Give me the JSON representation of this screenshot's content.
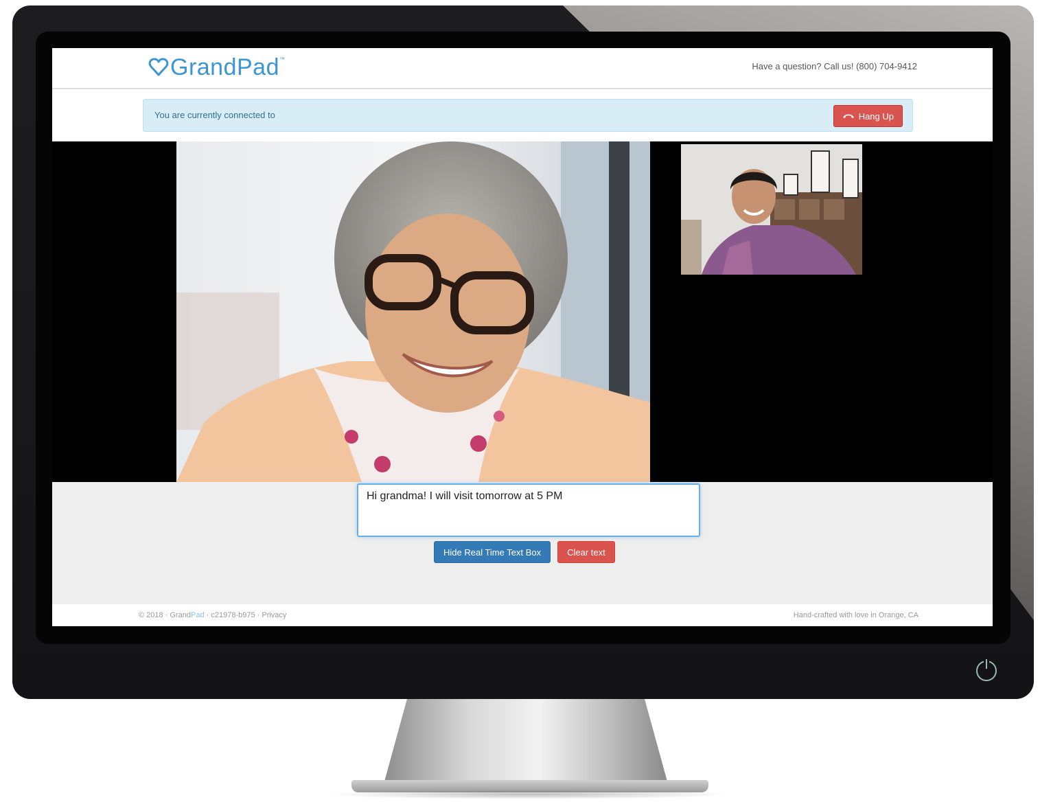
{
  "header": {
    "logo_text": "GrandPad",
    "logo_mark": "™",
    "help_text": "Have a question? Call us! (800) 704-9412"
  },
  "status": {
    "message": "You are currently connected to",
    "hangup_label": "Hang Up",
    "hangup_icon": "phone-hangup-icon"
  },
  "video": {
    "remote_description": "remote-video-feed",
    "local_description": "local-video-feed"
  },
  "rtt": {
    "text": "Hi grandma! I will visit tomorrow at 5 PM",
    "hide_label": "Hide Real Time Text Box",
    "clear_label": "Clear text"
  },
  "footer": {
    "copyright": "© 2018 · ",
    "brand_grand": "Grand",
    "brand_pad": "Pad",
    "version": " · c21978-b975 · ",
    "privacy": "Privacy",
    "tagline": "Hand-crafted with love in Orange, CA"
  },
  "colors": {
    "brand": "#3d95d4",
    "danger": "#d9534f",
    "primary": "#337ab7",
    "info_bg": "#d9edf7"
  }
}
